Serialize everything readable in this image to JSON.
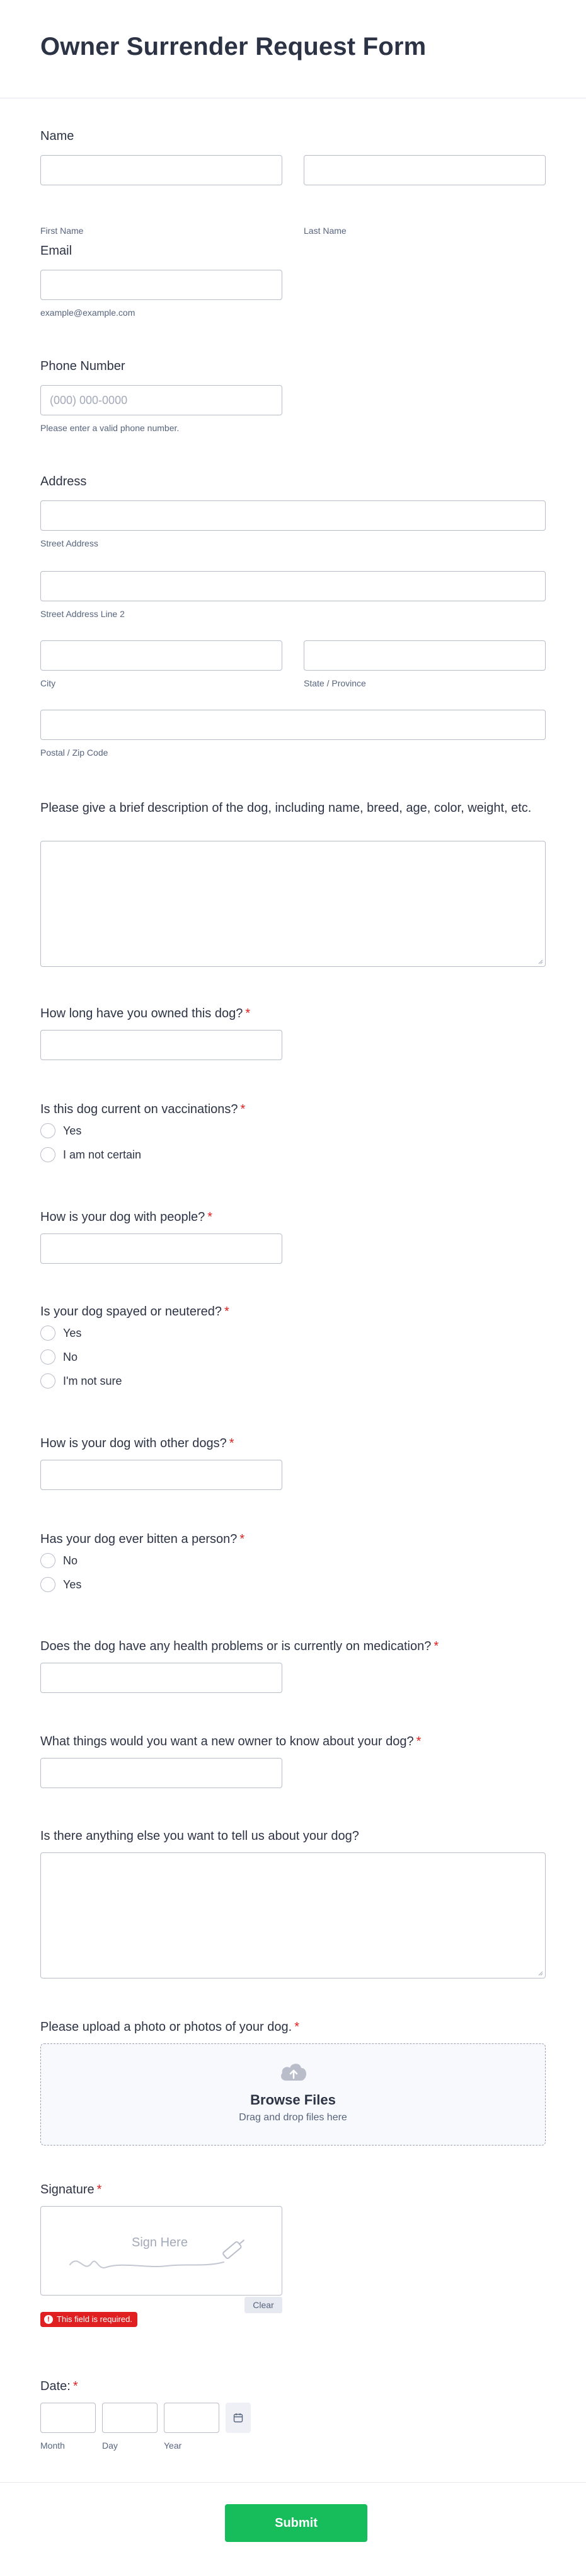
{
  "form": {
    "title": "Owner Surrender Request Form",
    "name": {
      "label": "Name",
      "first_sub": "First Name",
      "last_sub": "Last Name"
    },
    "email": {
      "label": "Email",
      "sub": "example@example.com"
    },
    "phone": {
      "label": "Phone Number",
      "placeholder": "(000) 000-0000",
      "sub": "Please enter a valid phone number."
    },
    "address": {
      "label": "Address",
      "street_sub": "Street Address",
      "street2_sub": "Street Address Line 2",
      "city_sub": "City",
      "state_sub": "State / Province",
      "zip_sub": "Postal / Zip Code"
    },
    "description": {
      "label": "Please give a brief description of the dog, including name, breed, age, color, weight, etc."
    },
    "owned": {
      "label": "How long have you owned this dog?",
      "req": "*"
    },
    "vaccinations": {
      "label": "Is this dog current on vaccinations?",
      "req": "*",
      "options": [
        "Yes",
        "I am not certain"
      ]
    },
    "people": {
      "label": "How is your dog with people?",
      "req": "*"
    },
    "spayed": {
      "label": "Is your dog spayed or neutered?",
      "req": "*",
      "options": [
        "Yes",
        "No",
        "I'm not sure"
      ]
    },
    "other_dogs": {
      "label": "How is your dog with other dogs?",
      "req": "*"
    },
    "bitten": {
      "label": "Has your dog ever bitten a person?",
      "req": "*",
      "options": [
        "No",
        "Yes"
      ]
    },
    "health": {
      "label": "Does the dog have any health problems or is currently on medication?",
      "req": "*"
    },
    "new_owner": {
      "label": "What things would you want a new owner to know about your dog?",
      "req": "*"
    },
    "anything_else": {
      "label": "Is there anything else you want to tell us about your dog?"
    },
    "upload": {
      "label": "Please upload a photo or photos of your dog.",
      "req": "*",
      "title": "Browse Files",
      "sub": "Drag and drop files here"
    },
    "signature": {
      "label": "Signature",
      "req": "*",
      "placeholder": "Sign Here",
      "clear": "Clear",
      "error": "This field is required.",
      "error_icon": "!"
    },
    "date": {
      "label": "Date:",
      "req": "*",
      "month_sub": "Month",
      "day_sub": "Day",
      "year_sub": "Year"
    },
    "submit": "Submit"
  },
  "colors": {
    "accent": "#18bd5b",
    "error": "#e02020",
    "border": "#b8bdc9",
    "text": "#2c3345",
    "subtext": "#57647e"
  }
}
